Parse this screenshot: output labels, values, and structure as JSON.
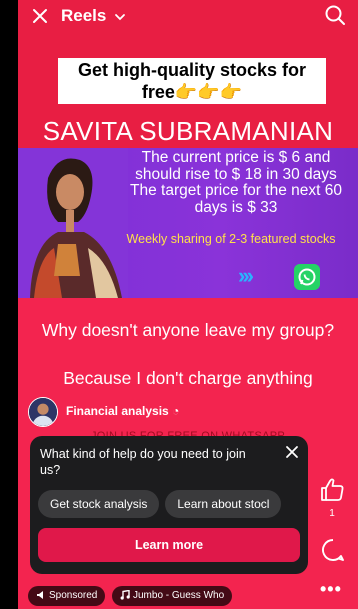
{
  "header": {
    "title": "Reels",
    "close_icon": "close-icon",
    "dropdown_icon": "chevron-down-icon",
    "search_icon": "search-icon"
  },
  "ad": {
    "headline_line1": "Get high-quality stocks for",
    "headline_line2": "free",
    "headline_emoji": "👉👉👉",
    "name": "SAVITA SUBRAMANIAN",
    "price_text": "The current price is $ 6 and should rise to $ 18 in 30 days The target price for the next 60 days is $ 33",
    "weekly_text": "Weekly sharing of 2-3 featured stocks",
    "arrows": "›››",
    "question1": "Why doesn't anyone leave my group?",
    "question2": "Because I don't charge anything",
    "join_text": "JOIN US FOR FREE ON WHATSAPP"
  },
  "account": {
    "name": "Financial analysis",
    "badge": "◔"
  },
  "actions": {
    "like_count": "1",
    "more_label": "•••"
  },
  "card": {
    "question": "What kind of help do you need to join us?",
    "chips": [
      "Get stock analysis",
      "Learn about stocl"
    ],
    "cta": "Learn more"
  },
  "footer": {
    "sponsored": "Sponsored",
    "music": "Jumbo - Guess Who"
  },
  "colors": {
    "top_red": "#e81e43",
    "purple": "#7b2fd6",
    "bottom_red": "#f3244f",
    "cta": "#e0184a",
    "card_bg": "#1c1c1e"
  }
}
